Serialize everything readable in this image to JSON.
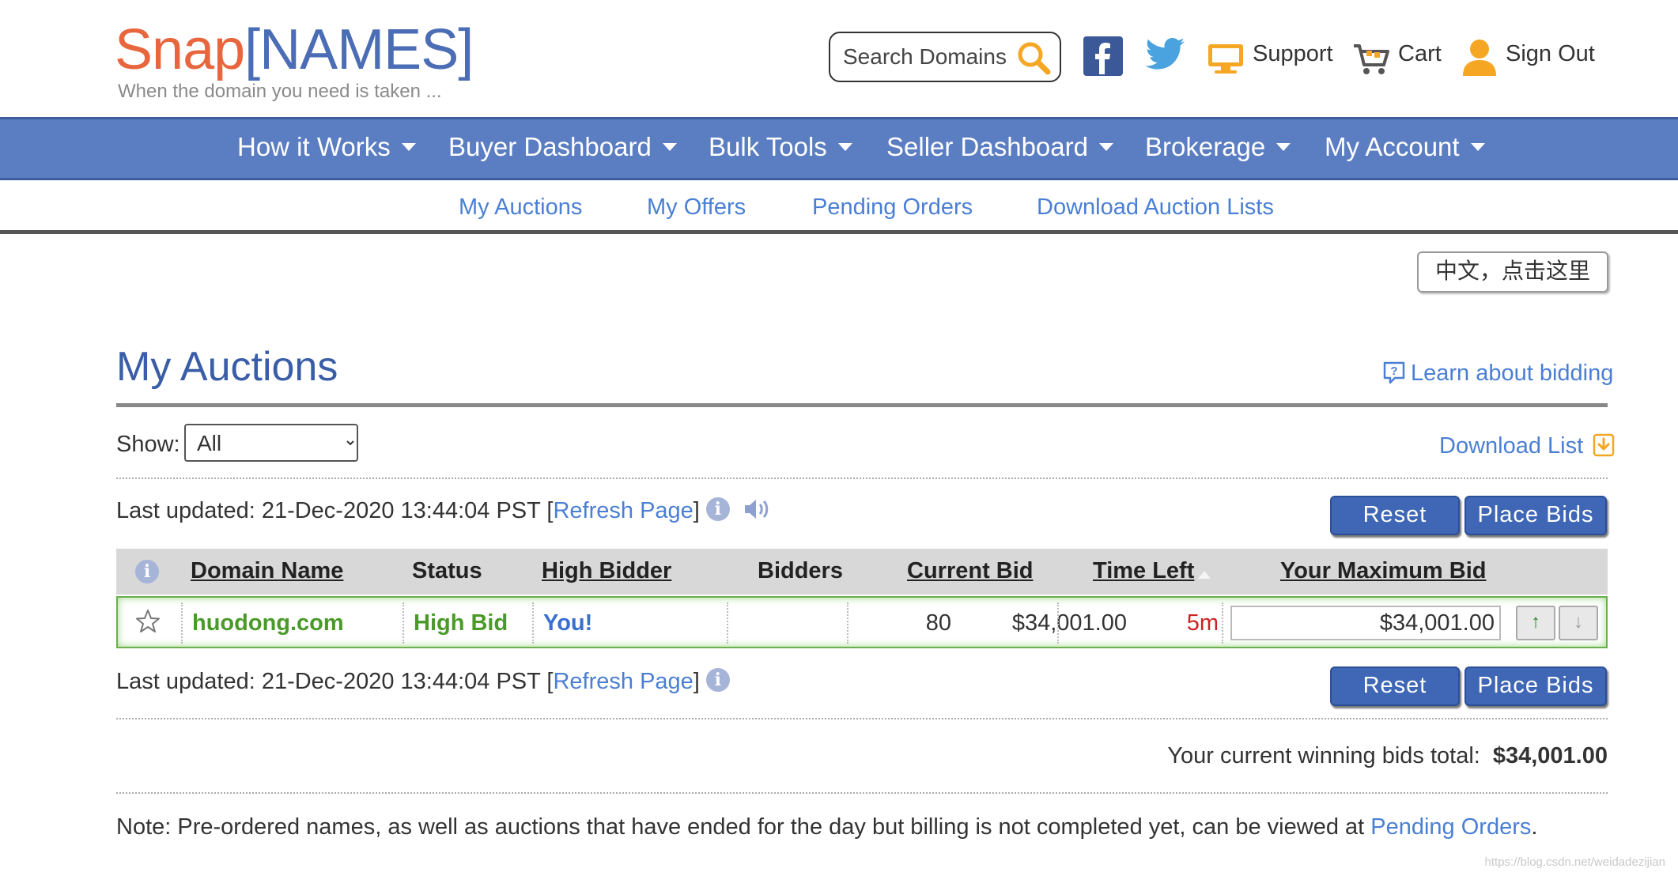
{
  "header": {
    "logo_snap": "Snap",
    "logo_names": "NAMES",
    "tagline": "When the domain you need is taken ...",
    "search_placeholder": "Search Domains",
    "support": "Support",
    "cart": "Cart",
    "sign_out": "Sign Out"
  },
  "nav": {
    "items": [
      {
        "label": "How it Works"
      },
      {
        "label": "Buyer Dashboard"
      },
      {
        "label": "Bulk Tools"
      },
      {
        "label": "Seller Dashboard"
      },
      {
        "label": "Brokerage"
      },
      {
        "label": "My Account"
      }
    ]
  },
  "subnav": {
    "items": [
      {
        "label": "My Auctions"
      },
      {
        "label": "My Offers"
      },
      {
        "label": "Pending Orders"
      },
      {
        "label": "Download Auction Lists"
      }
    ]
  },
  "language_button": "中文，点击这里",
  "page": {
    "title": "My Auctions",
    "learn_link": "Learn about bidding",
    "show_label": "Show:",
    "show_value": "All",
    "download_list": "Download List"
  },
  "updated": {
    "prefix": "Last updated: 21-Dec-2020 13:44:04 PST [",
    "refresh": "Refresh Page",
    "suffix": "]"
  },
  "buttons": {
    "reset": "Reset",
    "place_bids": "Place Bids"
  },
  "table": {
    "headers": {
      "domain": "Domain Name",
      "status": "Status",
      "high_bidder": "High Bidder",
      "bidders": "Bidders",
      "current_bid": "Current Bid",
      "time_left": "Time Left",
      "max_bid": "Your Maximum Bid"
    },
    "rows": [
      {
        "domain": "huodong.com",
        "status": "High Bid",
        "high_bidder": "You!",
        "bidders": "80",
        "current_bid": "$34,001.00",
        "time_left": "5m",
        "max_bid": "$34,001.00"
      }
    ]
  },
  "summary": {
    "label": "Your current winning bids total:",
    "value": "$34,001.00"
  },
  "note": {
    "text": "Note: Pre-ordered names, as well as auctions that have ended for the day but billing is not completed yet, can be viewed at ",
    "link": "Pending Orders",
    "end": "."
  },
  "watermark": "https://blog.csdn.net/weidadezijian",
  "colors": {
    "nav_bg": "#5b7dc2",
    "link": "#4a7fd4",
    "title": "#3a5da8",
    "logo_orange": "#e8663d",
    "status_green": "#4a9a2a",
    "time_red": "#cc2222",
    "button_blue": "#3f67b6"
  }
}
